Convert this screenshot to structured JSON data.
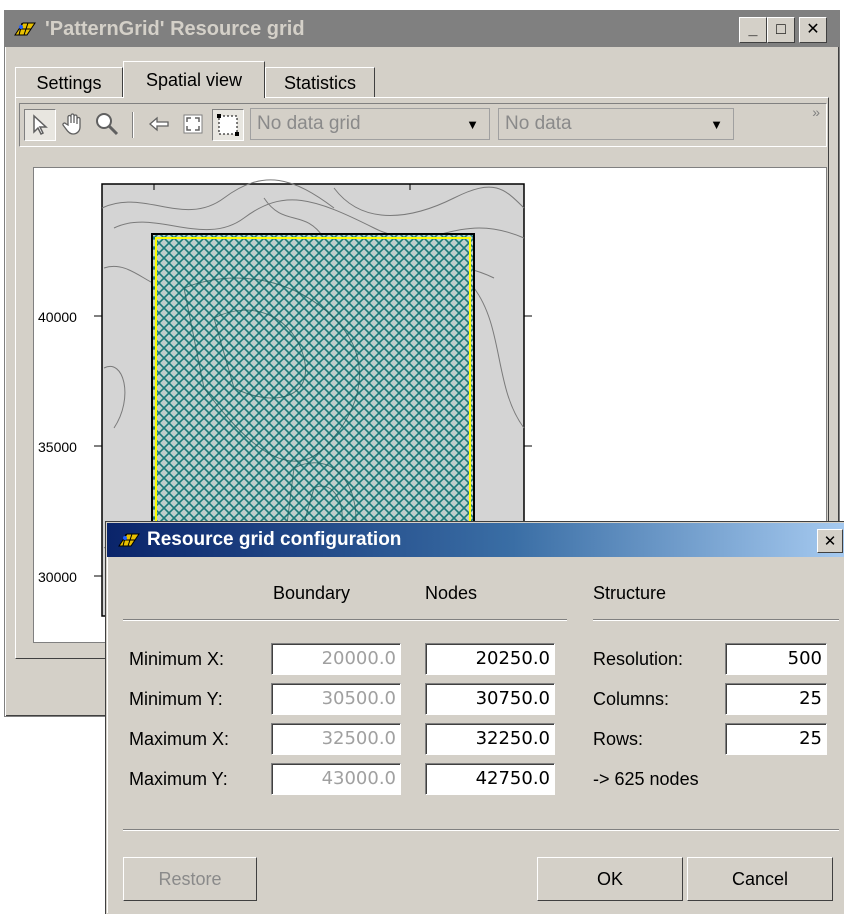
{
  "window": {
    "title": "'PatternGrid' Resource grid",
    "controls": {
      "minimize": "_",
      "maximize": "□",
      "close": "✕"
    }
  },
  "tabs": [
    {
      "label": "Settings",
      "active": false
    },
    {
      "label": "Spatial view",
      "active": true
    },
    {
      "label": "Statistics",
      "active": false
    }
  ],
  "toolbar": {
    "tools": [
      "pointer-icon",
      "pan-hand-icon",
      "zoom-icon",
      "back-arrow-icon",
      "zoom-extent-icon",
      "select-grid-icon"
    ],
    "grid_select": "No data grid",
    "data_select": "No data",
    "overflow": "»"
  },
  "map": {
    "y_ticks": [
      "40000",
      "35000",
      "30000"
    ],
    "colors": {
      "hatch": "#1a7a78",
      "boundary": "#ffff00",
      "background": "#d4d4d4",
      "contour": "#7a7a7a"
    }
  },
  "dialog": {
    "title": "Resource grid configuration",
    "close": "✕",
    "headers": {
      "boundary": "Boundary",
      "nodes": "Nodes",
      "structure": "Structure"
    },
    "rows": [
      {
        "label": "Minimum X:",
        "boundary": "20000.0",
        "nodes": "20250.0"
      },
      {
        "label": "Minimum Y:",
        "boundary": "30500.0",
        "nodes": "30750.0"
      },
      {
        "label": "Maximum X:",
        "boundary": "32500.0",
        "nodes": "32250.0"
      },
      {
        "label": "Maximum Y:",
        "boundary": "43000.0",
        "nodes": "42750.0"
      }
    ],
    "structure": {
      "resolution_label": "Resolution:",
      "resolution": "500",
      "columns_label": "Columns:",
      "columns": "25",
      "rows_label": "Rows:",
      "rows": "25",
      "summary": "-> 625 nodes"
    },
    "buttons": {
      "restore": "Restore",
      "ok": "OK",
      "cancel": "Cancel"
    }
  }
}
